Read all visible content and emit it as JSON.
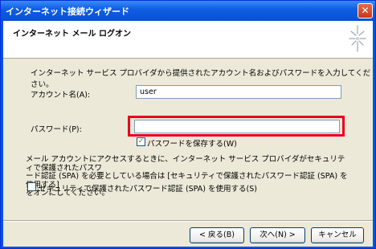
{
  "window": {
    "title": "インターネット接続ウィザード",
    "close_glyph": "✕"
  },
  "header": {
    "title": "インターネット メール ログオン",
    "icon": "wizard-sparkle-icon"
  },
  "form": {
    "description": "インターネット サービス プロバイダから提供されたアカウント名およびパスワードを入力してください。",
    "account_label": "アカウント名(A):",
    "account_value": "user",
    "password_label": "パスワード(P):",
    "password_value": "",
    "remember_password_label": "パスワードを保存する(W)",
    "remember_password_checked": true,
    "notice_lines": [
      "メール アカウントにアクセスするときに、インターネット サービス プロバイダがセキュリティで保護されたパスワ",
      "ード認証 (SPA) を必要としている場合は [セキュリティで保護されたパスワード認証 (SPA) を使用する]",
      "をオンにしてください。"
    ],
    "spa_label": "セキュリティで保護されたパスワード認証 (SPA) を使用する(S)",
    "spa_checked": false
  },
  "buttons": {
    "back": "< 戻る(B)",
    "next": "次へ(N) >",
    "cancel": "キャンセル"
  },
  "colors": {
    "title_bar": "#0f5fe6",
    "highlight": "#e8001c",
    "dialog_bg": "#ece9d8"
  }
}
